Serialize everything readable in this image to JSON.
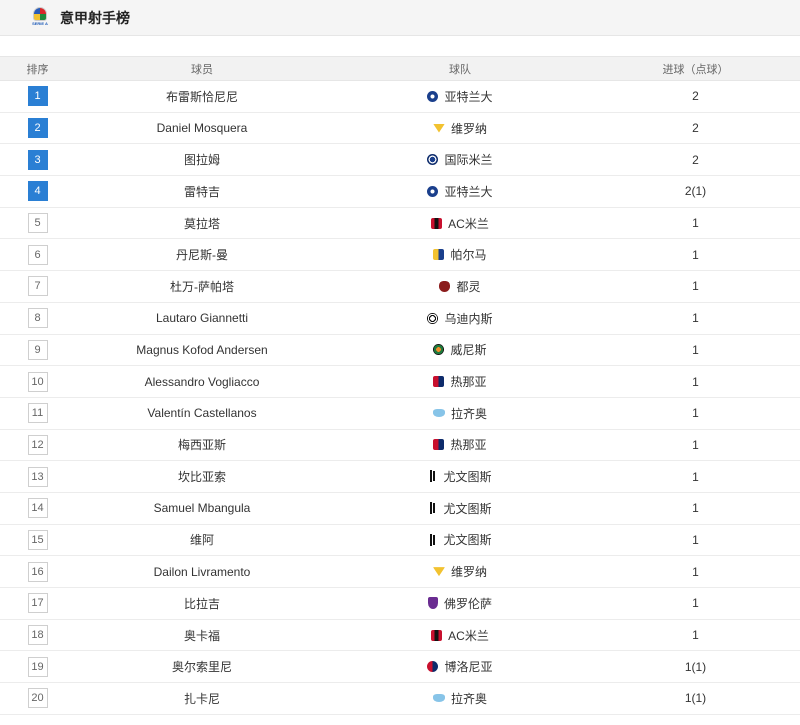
{
  "header": {
    "league_logo_text": "SERIE A",
    "title": "意甲射手榜"
  },
  "table": {
    "columns": [
      "排序",
      "球员",
      "球队",
      "进球（点球）"
    ],
    "rows": [
      {
        "rank": "1",
        "player": "布雷斯恰尼尼",
        "team": "亚特兰大",
        "badge": "atalanta",
        "goals": "2"
      },
      {
        "rank": "2",
        "player": "Daniel Mosquera",
        "team": "维罗纳",
        "badge": "verona",
        "goals": "2"
      },
      {
        "rank": "3",
        "player": "图拉姆",
        "team": "国际米兰",
        "badge": "inter",
        "goals": "2"
      },
      {
        "rank": "4",
        "player": "雷特吉",
        "team": "亚特兰大",
        "badge": "atalanta",
        "goals": "2(1)"
      },
      {
        "rank": "5",
        "player": "莫拉塔",
        "team": "AC米兰",
        "badge": "milan",
        "goals": "1"
      },
      {
        "rank": "6",
        "player": "丹尼斯-曼",
        "team": "帕尔马",
        "badge": "parma",
        "goals": "1"
      },
      {
        "rank": "7",
        "player": "杜万-萨帕塔",
        "team": "都灵",
        "badge": "torino",
        "goals": "1"
      },
      {
        "rank": "8",
        "player": "Lautaro Giannetti",
        "team": "乌迪内斯",
        "badge": "udinese",
        "goals": "1"
      },
      {
        "rank": "9",
        "player": "Magnus Kofod Andersen",
        "team": "威尼斯",
        "badge": "venezia",
        "goals": "1"
      },
      {
        "rank": "10",
        "player": "Alessandro Vogliacco",
        "team": "热那亚",
        "badge": "genoa",
        "goals": "1"
      },
      {
        "rank": "11",
        "player": "Valentín Castellanos",
        "team": "拉齐奥",
        "badge": "lazio",
        "goals": "1"
      },
      {
        "rank": "12",
        "player": "梅西亚斯",
        "team": "热那亚",
        "badge": "genoa",
        "goals": "1"
      },
      {
        "rank": "13",
        "player": "坎比亚索",
        "team": "尤文图斯",
        "badge": "juve",
        "goals": "1"
      },
      {
        "rank": "14",
        "player": "Samuel Mbangula",
        "team": "尤文图斯",
        "badge": "juve",
        "goals": "1"
      },
      {
        "rank": "15",
        "player": "维阿",
        "team": "尤文图斯",
        "badge": "juve",
        "goals": "1"
      },
      {
        "rank": "16",
        "player": "Dailon Livramento",
        "team": "维罗纳",
        "badge": "verona",
        "goals": "1"
      },
      {
        "rank": "17",
        "player": "比拉吉",
        "team": "佛罗伦萨",
        "badge": "fiorentina",
        "goals": "1"
      },
      {
        "rank": "18",
        "player": "奥卡福",
        "team": "AC米兰",
        "badge": "milan",
        "goals": "1"
      },
      {
        "rank": "19",
        "player": "奥尔索里尼",
        "team": "博洛尼亚",
        "badge": "bologna",
        "goals": "1(1)"
      },
      {
        "rank": "20",
        "player": "扎卡尼",
        "team": "拉齐奥",
        "badge": "lazio",
        "goals": "1(1)"
      }
    ]
  },
  "colors": {
    "top_rank_bg": "#2a7fd4",
    "header_bg": "#f5f5f5",
    "row_border": "#ececec"
  }
}
